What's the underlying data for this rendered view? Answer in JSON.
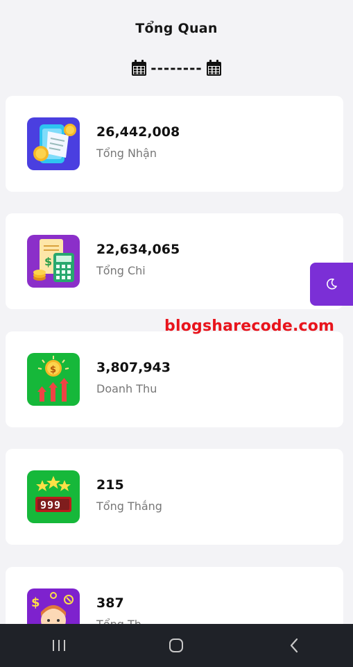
{
  "header": {
    "title": "Tổng Quan",
    "date_range": "--------",
    "icons": [
      "calendar-icon",
      "calendar-icon"
    ]
  },
  "cards": [
    {
      "value": "26,442,008",
      "label": "Tổng Nhận",
      "icon": "phone-receipt-coins-icon"
    },
    {
      "value": "22,634,065",
      "label": "Tổng Chi",
      "icon": "bill-calculator-icon"
    },
    {
      "value": "3,807,943",
      "label": "Doanh Thu",
      "icon": "revenue-coin-arrows-icon"
    },
    {
      "value": "215",
      "label": "Tổng Thắng",
      "icon": "jackpot-999-icon"
    },
    {
      "value": "387",
      "label": "Tổng Th",
      "icon": "stressed-person-money-icon"
    }
  ],
  "watermark": "blogsharecode.com",
  "theme_toggle_icon": "moon-icon",
  "nav": [
    "recent-apps-icon",
    "home-icon",
    "back-icon"
  ],
  "colors": {
    "accent": "#7b2fd6",
    "watermark": "#e8141c",
    "navbar": "#1f2228",
    "background": "#f3f3f6"
  }
}
